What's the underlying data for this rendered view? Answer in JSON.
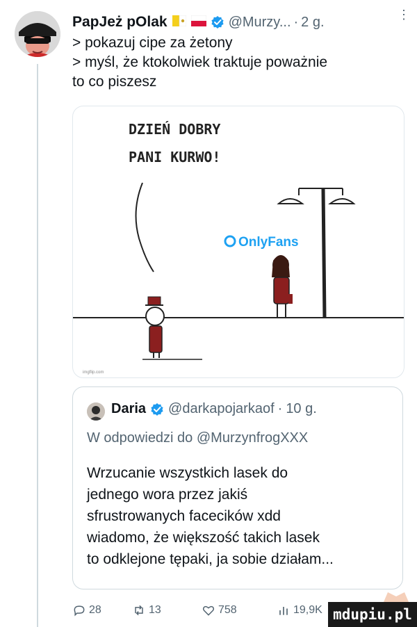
{
  "tweet": {
    "author_name": "PapJeż pOlak",
    "handle": "@Murzy...",
    "separator": "·",
    "time": "2 g.",
    "more_glyph": "⋮",
    "lines": [
      "> pokazuj cipe za żetony",
      "> myśl, że ktokolwiek traktuje poważnie",
      "to co piszesz"
    ]
  },
  "media": {
    "handwritten_line1": "DZIEŃ DOBRY",
    "handwritten_line2": "PANI KURWO!",
    "logo_text": "OnlyFans",
    "source_text": "imgflip.com"
  },
  "quote": {
    "author_name": "Daria",
    "handle": "@darkapojarkaof",
    "separator": "·",
    "time": "10 g.",
    "reply_to": "W odpowiedzi do @MurzynfrogXXX",
    "text_lines": [
      "Wrzucanie wszystkich lasek do",
      "jednego wora przez jakiś",
      "sfrustrowanych facecików xdd",
      "wiadomo, że większość takich lasek",
      "to odklejone tępaki, ja sobie działam..."
    ]
  },
  "actions": {
    "replies": "28",
    "retweets": "13",
    "likes": "758",
    "views": "19,9K"
  },
  "watermark": {
    "text": "mdupiu.pl"
  },
  "icons": {
    "verified": "verified-badge-icon",
    "reply": "reply-icon",
    "retweet": "retweet-icon",
    "like": "heart-icon",
    "views": "views-icon",
    "more": "more-icon"
  },
  "colors": {
    "accent": "#1d9bf0",
    "secondary_text": "#536471",
    "border": "#cfd9de"
  }
}
